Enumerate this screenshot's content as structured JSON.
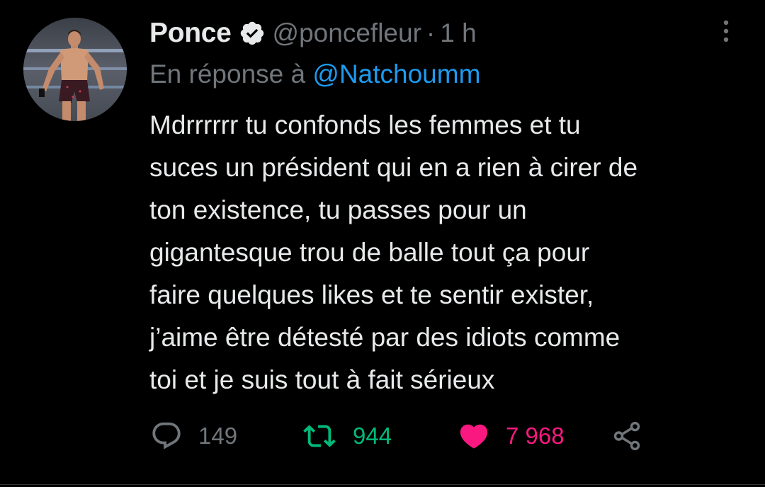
{
  "tweet": {
    "display_name": "Ponce",
    "verified_icon": "verified-badge-icon",
    "handle": "@poncefleur",
    "separator": "·",
    "time": "1 h",
    "reply_prefix": "En réponse à",
    "reply_mention": "@Natchoumm",
    "text": "Mdrrrrrr tu confonds les femmes et tu\nsuces un président qui en a rien à cirer de\nton existence, tu passes pour un\ngigantesque trou de balle tout ça pour\nfaire quelques likes et te sentir exister,\nj’aime être détesté par des idiots comme\ntoi et je suis tout à fait sérieux"
  },
  "actions": {
    "reply": {
      "icon": "reply-bubble-icon",
      "count": "149"
    },
    "retweet": {
      "icon": "retweet-icon",
      "count": "944",
      "active": true
    },
    "like": {
      "icon": "heart-icon",
      "count": "7 968",
      "active": true
    },
    "share": {
      "icon": "share-icon"
    }
  },
  "colors": {
    "background": "#000000",
    "text_primary": "#e7e9ea",
    "text_secondary": "#71767b",
    "link": "#1d9bf0",
    "retweet_active": "#00ba7c",
    "like_active": "#f91880"
  }
}
